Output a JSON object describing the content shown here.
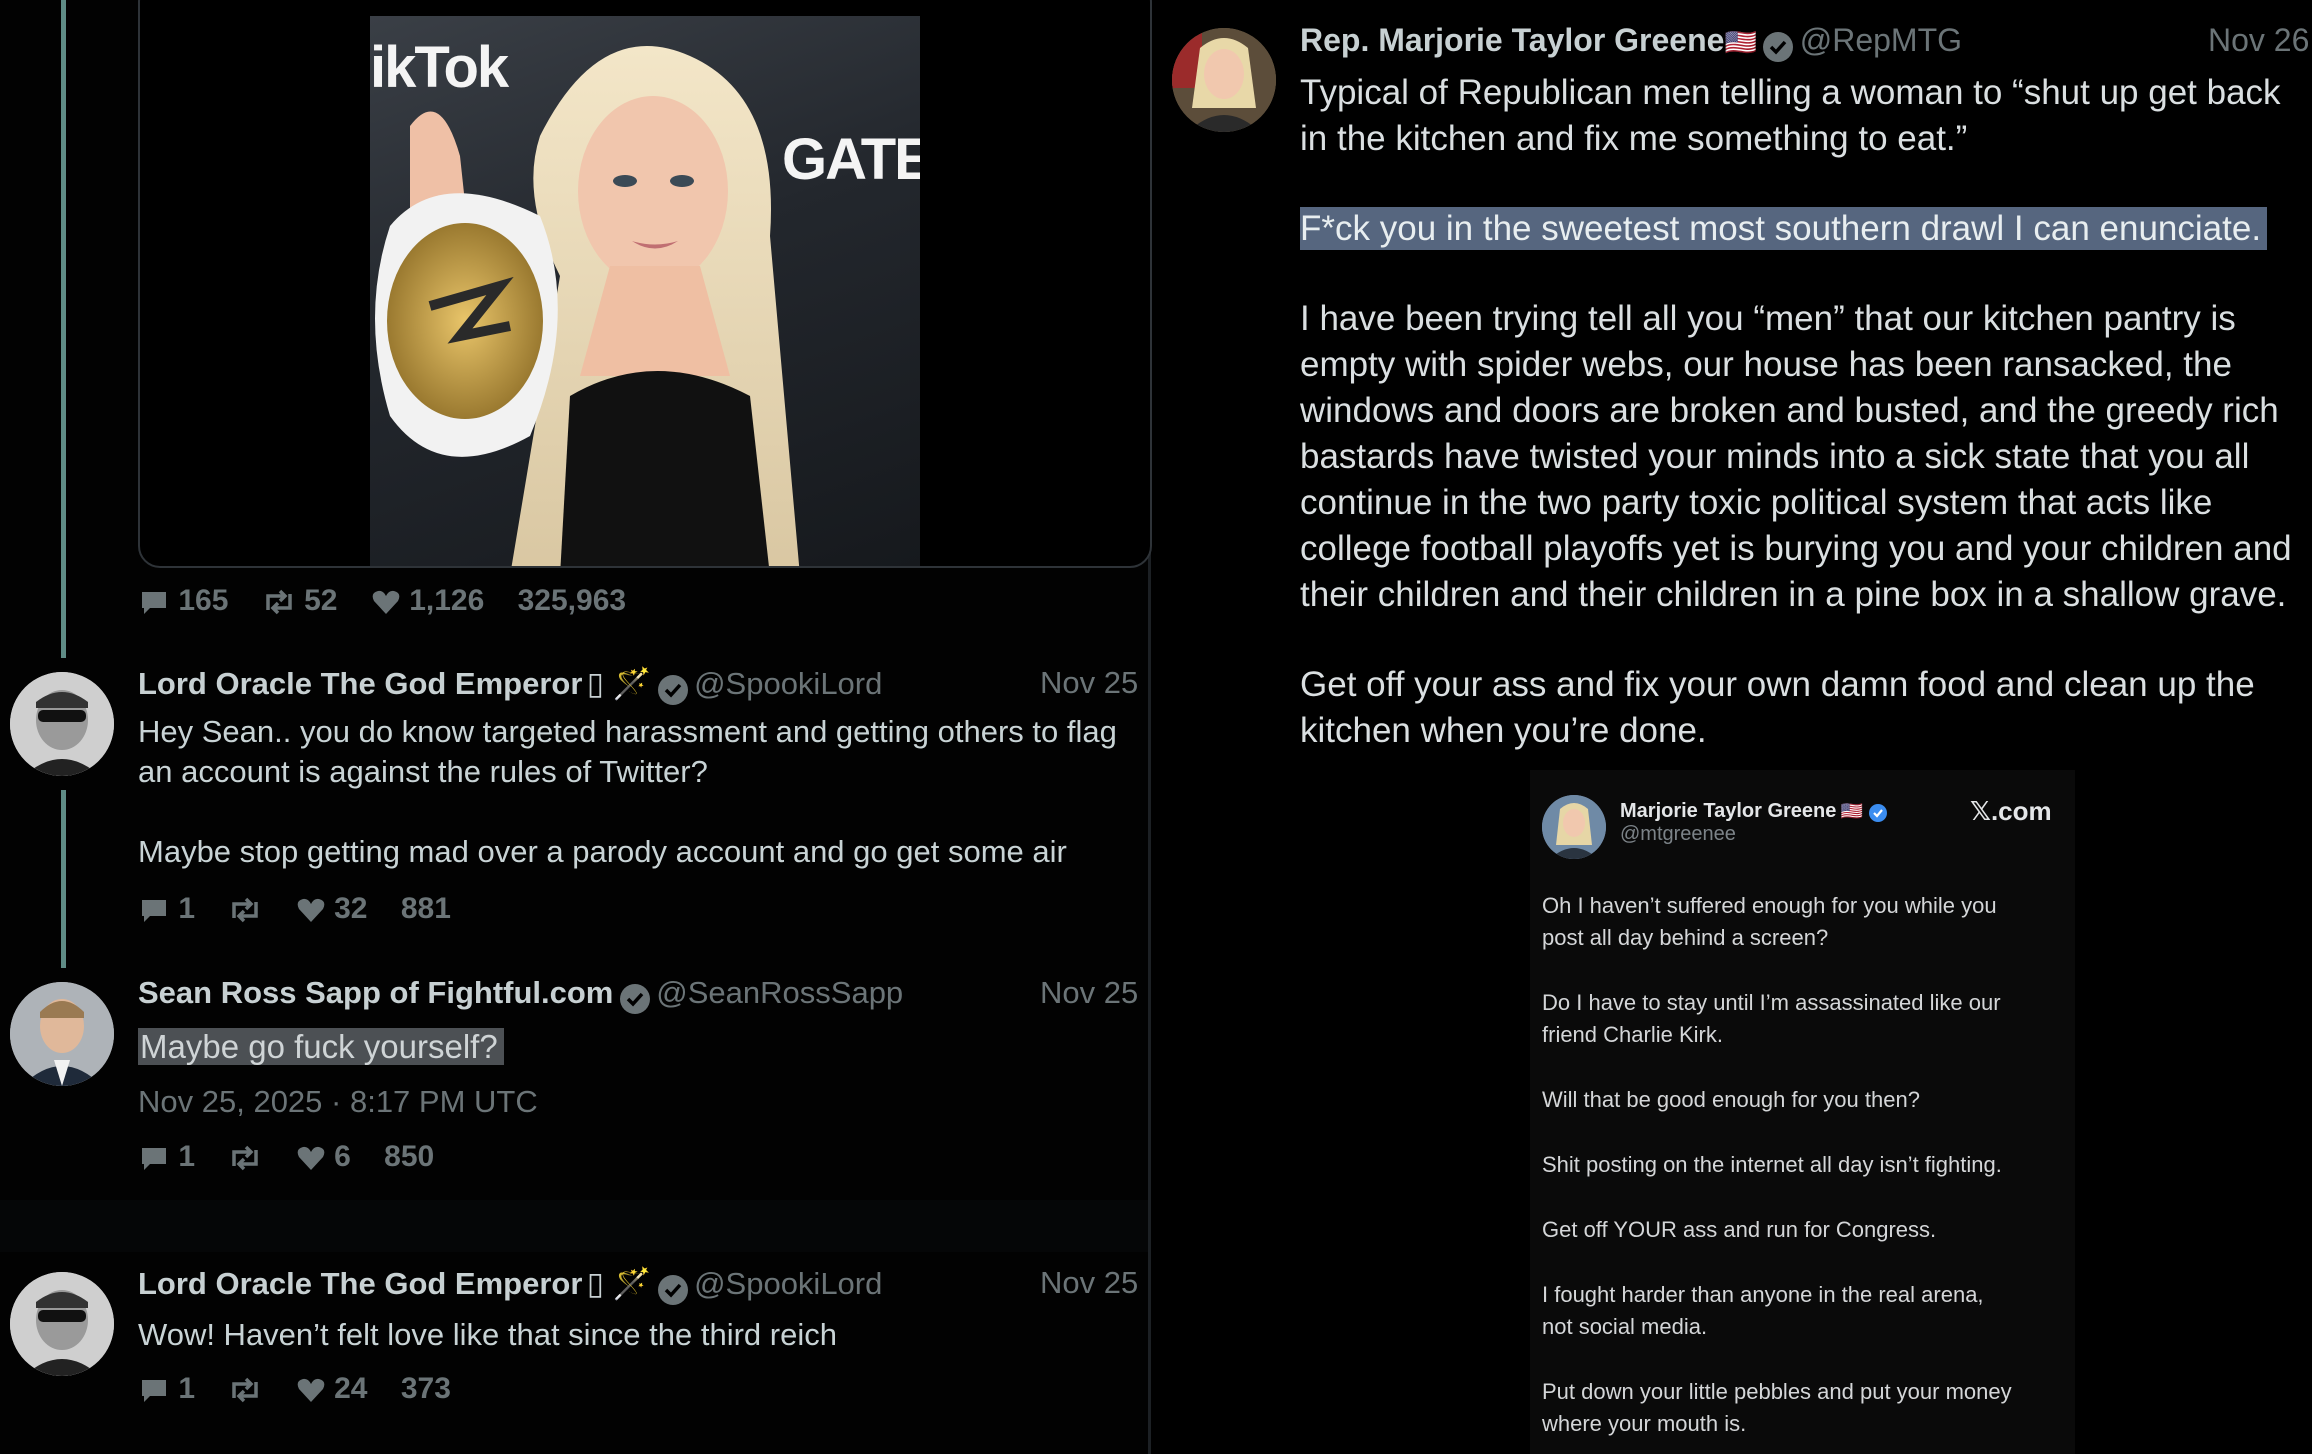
{
  "left_panel": {
    "media_tweet": {
      "image_alt": "Woman holding championship belt at TikTok Gate event",
      "image_text_1": "ikTok",
      "image_text_2": "GATE",
      "metrics": {
        "replies": "165",
        "retweets": "52",
        "likes": "1,126",
        "views": "325,963"
      }
    },
    "tweet1": {
      "name": "Lord Oracle The God Emperor",
      "name_suffix": "▯ 🪄",
      "handle": "@SpookiLord",
      "date": "Nov 25",
      "text_line1": "Hey Sean.. you do know targeted harassment and getting others to flag",
      "text_line2": "an account is against the rules of Twitter?",
      "text_line3": "Maybe stop getting mad over a parody account and go get some air",
      "metrics": {
        "replies": "1",
        "retweets": "",
        "likes": "32",
        "views": "881"
      }
    },
    "tweet2": {
      "name": "Sean Ross Sapp of Fightful.com",
      "handle": "@SeanRossSapp",
      "date": "Nov 25",
      "text": "Maybe go fuck yourself?",
      "timestamp": "Nov 25, 2025 · 8:17 PM UTC",
      "metrics": {
        "replies": "1",
        "retweets": "",
        "likes": "6",
        "views": "850"
      }
    },
    "tweet3": {
      "name": "Lord Oracle The God Emperor",
      "name_suffix": "▯ 🪄",
      "handle": "@SpookiLord",
      "date": "Nov 25",
      "text": "Wow! Haven’t felt love like that since the third reich",
      "metrics": {
        "replies": "1",
        "retweets": "",
        "likes": "24",
        "views": "373"
      }
    }
  },
  "right_panel": {
    "name": "Rep. Marjorie Taylor Greene",
    "flag": "🇺🇸",
    "handle": "@RepMTG",
    "date": "Nov 26",
    "p1_line1": "Typical of Republican men telling a woman to “shut up get back",
    "p1_line2": "in the kitchen and fix me something to eat.”",
    "p2": "F*ck you in the sweetest most southern drawl I can enunciate.",
    "p3_lines": [
      "I have been trying tell all you “men” that our kitchen pantry is",
      "empty with spider webs, our house has been ransacked, the",
      "windows and doors are broken and busted, and the greedy rich",
      "bastards have twisted your minds into a sick state that you all",
      "continue in the two party toxic political system that acts like",
      "college football playoffs yet is burying you and your children and",
      "their children and their children in a pine box in a shallow grave."
    ],
    "p4_line1": "Get off your ass and fix your own damn food and clean up the",
    "p4_line2": "kitchen when you’re done.",
    "embed": {
      "name": "Marjorie Taylor Greene",
      "flag": "🇺🇸",
      "handle": "@mtgreenee",
      "brand": "𝕏.com",
      "lines": [
        "Oh I haven’t suffered enough for you while you",
        "post all day behind a screen?",
        "Do I have to stay until I’m assassinated like our",
        "friend Charlie Kirk.",
        "Will that be good enough for you then?",
        "Shit posting on the internet all day isn’t fighting.",
        "Get off YOUR ass and run for Congress.",
        "I fought harder than anyone in the real arena,",
        "not social media.",
        "Put down your little pebbles and put your money",
        "where your mouth is."
      ]
    }
  }
}
